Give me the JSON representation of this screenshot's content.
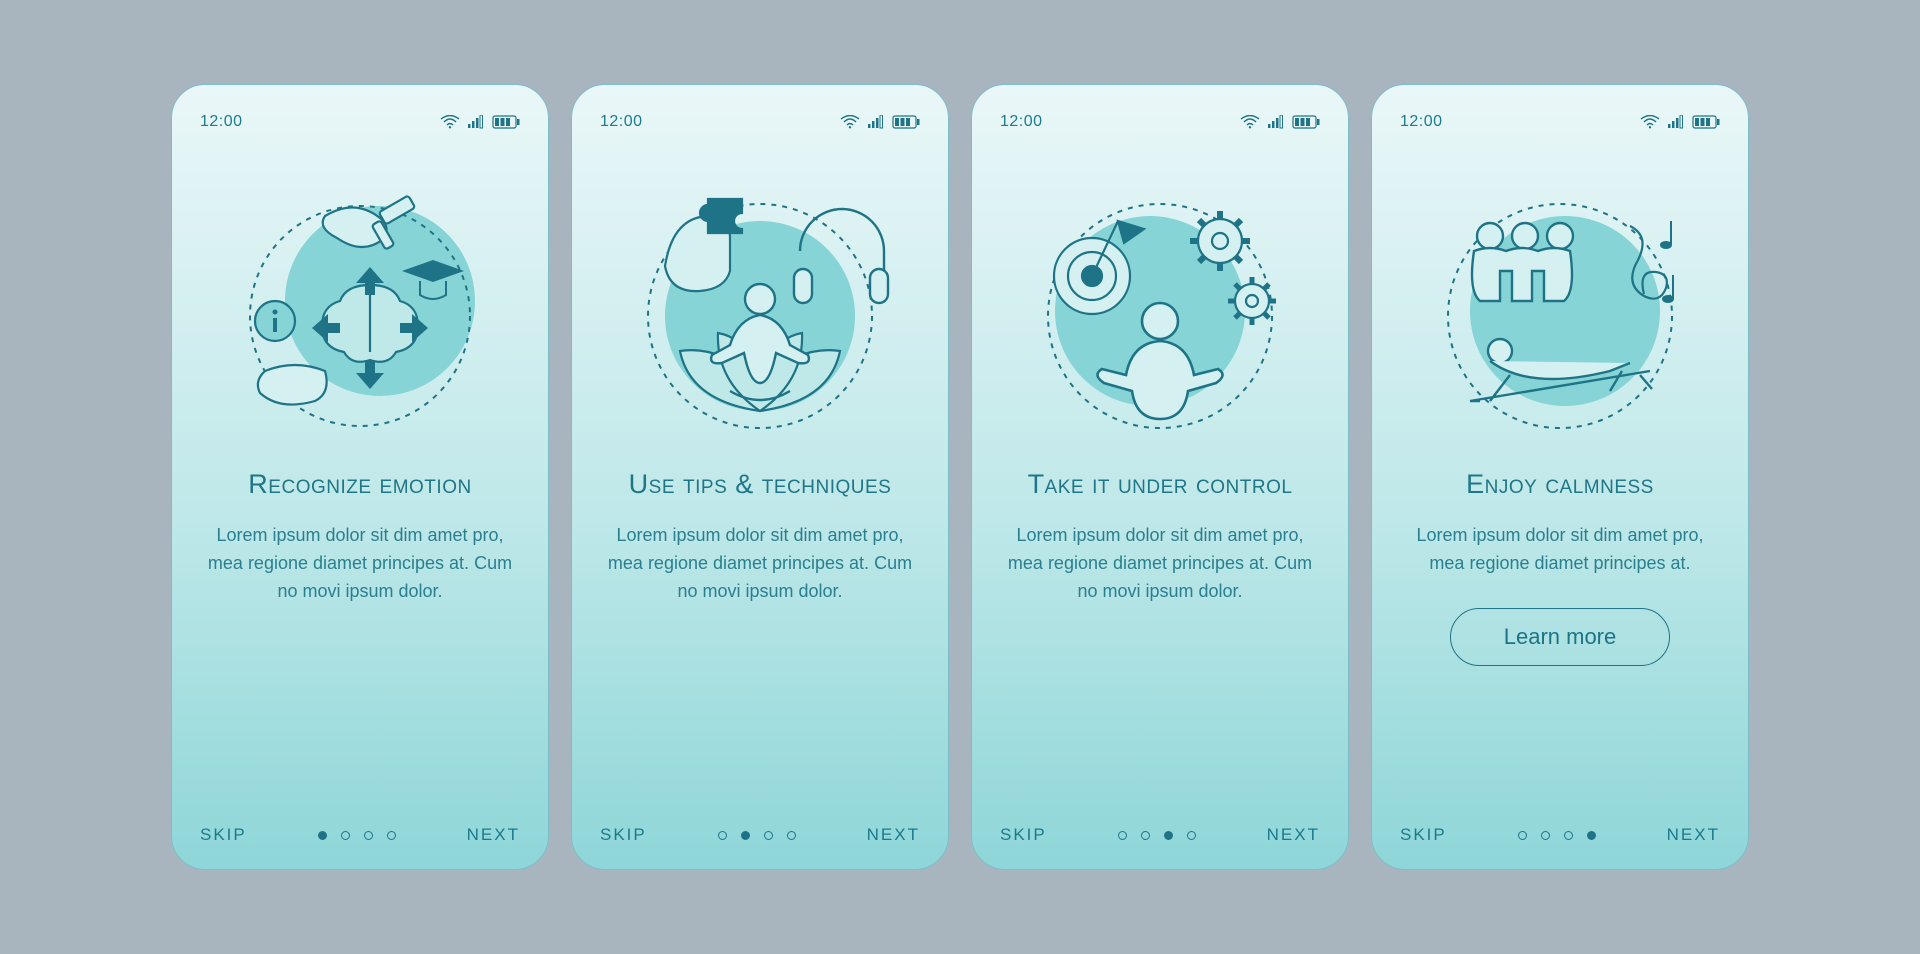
{
  "colors": {
    "stroke": "#1e7486",
    "accentFill": "#86d4d6",
    "lightFill": "#d4f0f1"
  },
  "status": {
    "time": "12:00"
  },
  "nav": {
    "skip": "SKIP",
    "next": "NEXT"
  },
  "screens": [
    {
      "title": "Recognize emotion",
      "body": "Lorem ipsum dolor sit dim amet pro, mea regione diamet principes at. Cum no movi ipsum dolor.",
      "icon": "brain-arrows",
      "activeDot": 0,
      "cta": null
    },
    {
      "title": "Use tips & techniques",
      "body": "Lorem ipsum dolor sit dim amet pro, mea regione diamet principes at. Cum no movi ipsum dolor.",
      "icon": "meditation",
      "activeDot": 1,
      "cta": null
    },
    {
      "title": "Take it under control",
      "body": "Lorem ipsum dolor sit dim amet pro, mea regione diamet principes at. Cum no movi ipsum dolor.",
      "icon": "control-gears",
      "activeDot": 2,
      "cta": null
    },
    {
      "title": "Enjoy calmness",
      "body": "Lorem ipsum dolor sit dim amet pro, mea regione diamet principes at.",
      "icon": "calmness",
      "activeDot": 3,
      "cta": "Learn more"
    }
  ]
}
